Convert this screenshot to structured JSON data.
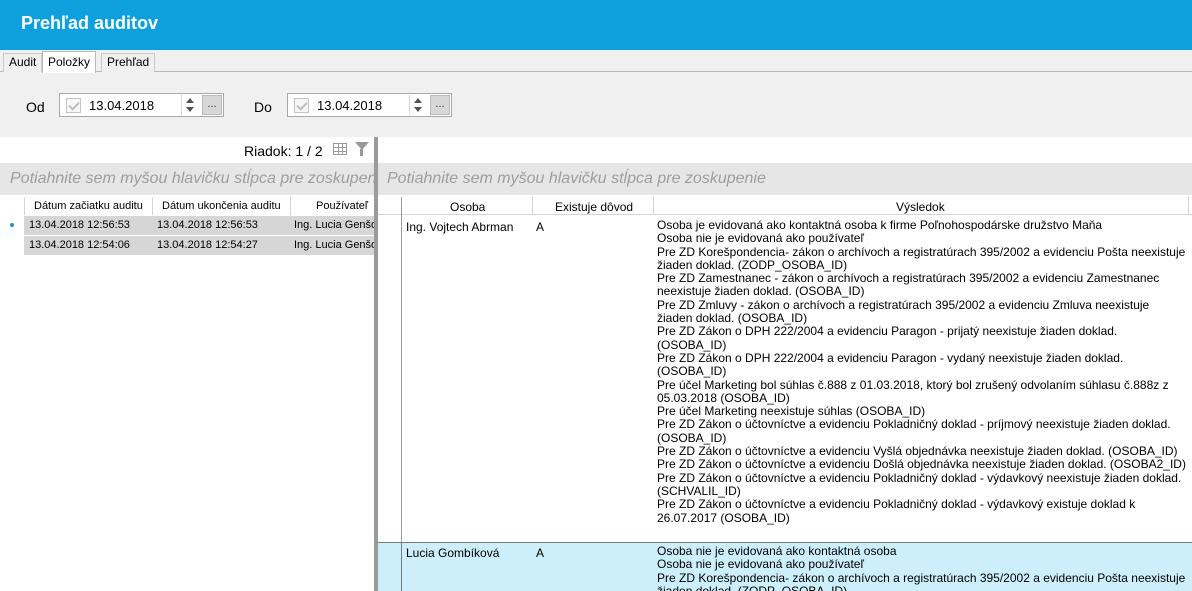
{
  "window": {
    "title": "Prehľad auditov"
  },
  "tabs": [
    {
      "label": "Audit",
      "active": false
    },
    {
      "label": "Položky",
      "active": true
    },
    {
      "label": "Prehľad",
      "active": false
    }
  ],
  "filter": {
    "from_label": "Od",
    "from_value": "13.04.2018",
    "to_label": "Do",
    "to_value": "13.04.2018",
    "ellipsis": "..."
  },
  "left_grid": {
    "row_info": "Riadok: 1 / 2",
    "group_hint": "Potiahnite sem myšou hlavičku stĺpca pre zoskupenie",
    "columns": [
      "Dátum začiatku auditu",
      "Dátum ukončenia auditu",
      "Používateľ"
    ],
    "rows": [
      [
        "13.04.2018 12:56:53",
        "13.04.2018 12:56:53",
        "Ing. Lucia Genšor"
      ],
      [
        "13.04.2018 12:54:06",
        "13.04.2018 12:54:27",
        "Ing. Lucia Genšor"
      ]
    ]
  },
  "right_grid": {
    "group_hint": "Potiahnite sem myšou hlavičku stĺpca pre zoskupenie",
    "columns": [
      "Osoba",
      "Existuje dôvod",
      "Výsledok"
    ],
    "rows": [
      {
        "osoba": "Ing. Vojtech Abrman",
        "dovod": "A",
        "vysledok": [
          "Osoba je evidovaná ako kontaktná osoba k firme Poľnohospodárske družstvo Maňa",
          "Osoba nie je evidovaná ako používateľ",
          "Pre ZD Korešpondencia- zákon o archívoch a registratúrach 395/2002 a evidenciu Pošta neexistuje žiaden doklad. (ZODP_OSOBA_ID)",
          "Pre ZD Zamestnanec - zákon o archívoch a registratúrach 395/2002 a evidenciu Zamestnanec neexistuje žiaden doklad. (OSOBA_ID)",
          "Pre ZD Zmluvy - zákon o archívoch a registratúrach 395/2002 a evidenciu Zmluva neexistuje žiaden doklad. (OSOBA_ID)",
          "Pre ZD Zákon o DPH 222/2004 a evidenciu Paragon - prijatý neexistuje žiaden doklad. (OSOBA_ID)",
          "Pre ZD Zákon o DPH 222/2004 a evidenciu Paragon - vydaný neexistuje žiaden doklad. (OSOBA_ID)",
          "Pre účel Marketing bol súhlas č.888 z 01.03.2018, ktorý bol zrušený odvolaním súhlasu č.888z z 05.03.2018 (OSOBA_ID)",
          "Pre účel Marketing neexistuje súhlas (OSOBA_ID)",
          "Pre ZD Zákon o účtovníctve a evidenciu Pokladničný doklad - príjmový neexistuje žiaden doklad. (OSOBA_ID)",
          "Pre ZD Zákon o účtovníctve a evidenciu Vyšlá objednávka neexistuje žiaden doklad. (OSOBA_ID)",
          "Pre ZD Zákon o účtovníctve a evidenciu Došlá objednávka neexistuje žiaden doklad. (OSOBA2_ID)",
          "Pre ZD Zákon o účtovníctve a evidenciu Pokladničný doklad - výdavkový neexistuje žiaden doklad. (SCHVALIL_ID)",
          "Pre ZD Zákon o účtovníctve a evidenciu Pokladničný doklad - výdavkový existuje doklad k 26.07.2017 (OSOBA_ID)"
        ]
      },
      {
        "osoba": "Lucia Gombíková",
        "dovod": "A",
        "vysledok": [
          "Osoba nie je evidovaná ako kontaktná osoba",
          "Osoba nie je evidovaná ako používateľ",
          "Pre ZD Korešpondencia- zákon o archívoch a registratúrach 395/2002 a evidenciu Pošta neexistuje žiaden doklad. (ZODP_OSOBA_ID)"
        ]
      }
    ]
  },
  "colors": {
    "title_bar": "#0ea0dc",
    "selected_row": "#cdeefb",
    "left_row_bg": "#d6d6d6",
    "group_hint_bg": "#e6e6e6"
  }
}
